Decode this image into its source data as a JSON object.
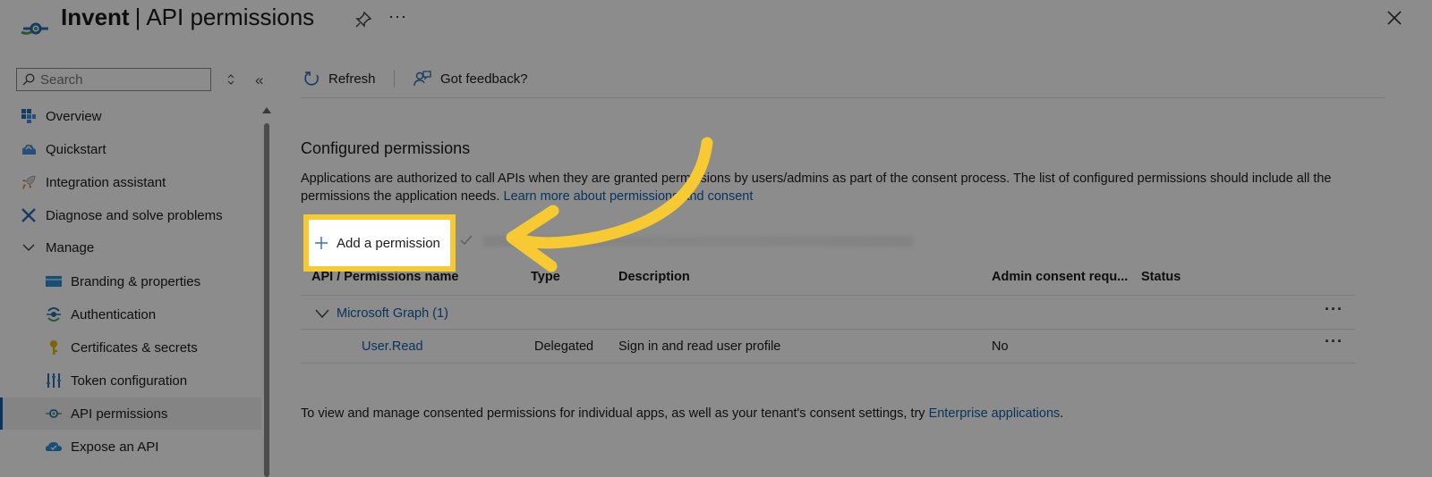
{
  "header": {
    "app_name": "Invent",
    "separator": "|",
    "page_name": "API permissions",
    "more_label": "···"
  },
  "sidebar": {
    "search": {
      "placeholder": "Search",
      "value": ""
    },
    "collapse_label": "«",
    "items": [
      {
        "label": "Overview",
        "icon": "overview-grid-icon"
      },
      {
        "label": "Quickstart",
        "icon": "quickstart-cloud-icon"
      },
      {
        "label": "Integration assistant",
        "icon": "rocket-icon"
      },
      {
        "label": "Diagnose and solve problems",
        "icon": "wrench-icon"
      },
      {
        "label": "Manage",
        "icon": "chevron-down-icon"
      },
      {
        "label": "Branding & properties",
        "icon": "branding-icon"
      },
      {
        "label": "Authentication",
        "icon": "authentication-icon"
      },
      {
        "label": "Certificates & secrets",
        "icon": "key-icon"
      },
      {
        "label": "Token configuration",
        "icon": "token-bars-icon"
      },
      {
        "label": "API permissions",
        "icon": "api-permissions-icon",
        "active": true
      },
      {
        "label": "Expose an API",
        "icon": "cloud-icon"
      }
    ]
  },
  "toolbar": {
    "refresh_label": "Refresh",
    "feedback_label": "Got feedback?"
  },
  "main": {
    "section_title": "Configured permissions",
    "description": "Applications are authorized to call APIs when they are granted permissions by users/admins as part of the consent process. The list of configured permissions should include all the permissions the application needs.",
    "learn_more_link": "Learn more about permissions and consent",
    "add_permission_label": "Add a permission",
    "table": {
      "headers": [
        "API / Permissions name",
        "Type",
        "Description",
        "Admin consent requ...",
        "Status"
      ],
      "group": {
        "label": "Microsoft Graph (1)",
        "more": "···"
      },
      "rows": [
        {
          "name": "User.Read",
          "type": "Delegated",
          "description": "Sign in and read user profile",
          "admin_consent": "No",
          "status": "",
          "more": "···"
        }
      ]
    },
    "footer": {
      "text": "To view and manage consented permissions for individual apps, as well as your tenant's consent settings, try",
      "link": "Enterprise applications",
      "end": "."
    }
  },
  "colors": {
    "link_blue": "#0f5fa8",
    "highlight_yellow": "#f7ca33",
    "overlay": "rgba(0,0,0,0.45)"
  }
}
